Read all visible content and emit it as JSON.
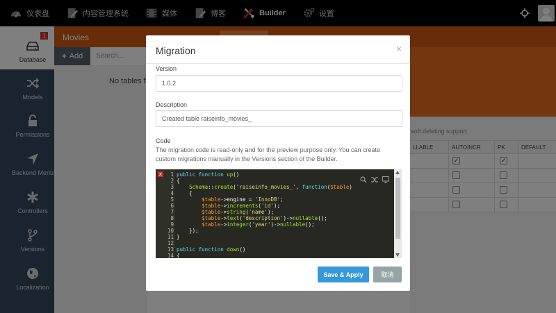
{
  "topbar": {
    "items": [
      {
        "label": "仪表盘",
        "icon": "dashboard-icon"
      },
      {
        "label": "内容管理系统",
        "icon": "cms-icon"
      },
      {
        "label": "媒体",
        "icon": "media-icon"
      },
      {
        "label": "博客",
        "icon": "blog-icon"
      },
      {
        "label": "Builder",
        "icon": "builder-icon"
      },
      {
        "label": "设置",
        "icon": "settings-icon"
      }
    ]
  },
  "sidebar": {
    "badge": "1",
    "items": [
      {
        "label": "Database",
        "icon": "database-icon"
      },
      {
        "label": "Models",
        "icon": "models-icon"
      },
      {
        "label": "Permissions",
        "icon": "lock-icon"
      },
      {
        "label": "Backend Menu",
        "icon": "location-arrow-icon"
      },
      {
        "label": "Controllers",
        "icon": "asterisk-icon"
      },
      {
        "label": "Versions",
        "icon": "branch-icon"
      },
      {
        "label": "Localization",
        "icon": "globe-icon"
      }
    ]
  },
  "background": {
    "title": "Movies",
    "add_label": "Add",
    "search_placeholder": "Search...",
    "no_tables": "No tables found",
    "soft_delete": "soft deleting support",
    "columns": [
      "LLABLE",
      "AUTOINCR",
      "PK",
      "DEFAULT"
    ]
  },
  "modal": {
    "title": "Migration",
    "close": "×",
    "version_label": "Version",
    "version_value": "1.0.2",
    "description_label": "Description",
    "description_value": "Created table raiseinfo_movies_",
    "code_label": "Code",
    "code_help": "The migration code is read-only and for the preview purpose only. You can create custom migrations manually in the Versions section of the Builder.",
    "error_marker": "x",
    "save_label": "Save & Apply",
    "cancel_label": "取消"
  }
}
